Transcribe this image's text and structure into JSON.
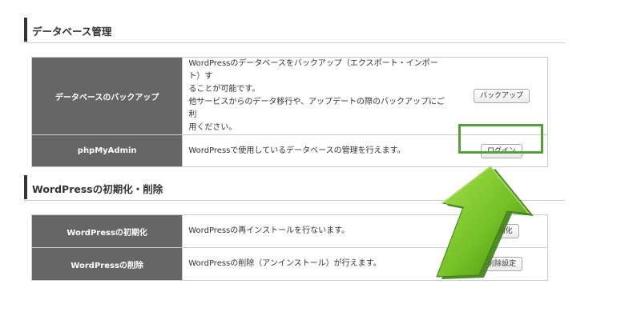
{
  "sections": [
    {
      "heading": "データベース管理",
      "rows": [
        {
          "label": "データベースのバックアップ",
          "description": [
            "WordPressのデータベースをバックアップ（エクスポート・インポート）す",
            "ることが可能です。",
            "他サービスからのデータ移行や、アップデートの際のバックアップにご利",
            "用ください。"
          ],
          "button": "バックアップ"
        },
        {
          "label": "phpMyAdmin",
          "description": [
            "WordPressで使用しているデータベースの管理を行えます。"
          ],
          "button": "ログイン"
        }
      ]
    },
    {
      "heading": "WordPressの初期化・削除",
      "rows": [
        {
          "label": "WordPressの初期化",
          "description": [
            "WordPressの再インストールを行ないます。"
          ],
          "button": "初期化"
        },
        {
          "label": "WordPressの削除",
          "description": [
            "WordPressの削除（アンインストール）が行えます。"
          ],
          "button": "削除設定"
        }
      ]
    }
  ],
  "colors": {
    "label_bg": "#666666",
    "highlight": "#54a13a",
    "arrow": "#78c32a"
  },
  "overlay_icon": "green-up-arrow-icon"
}
